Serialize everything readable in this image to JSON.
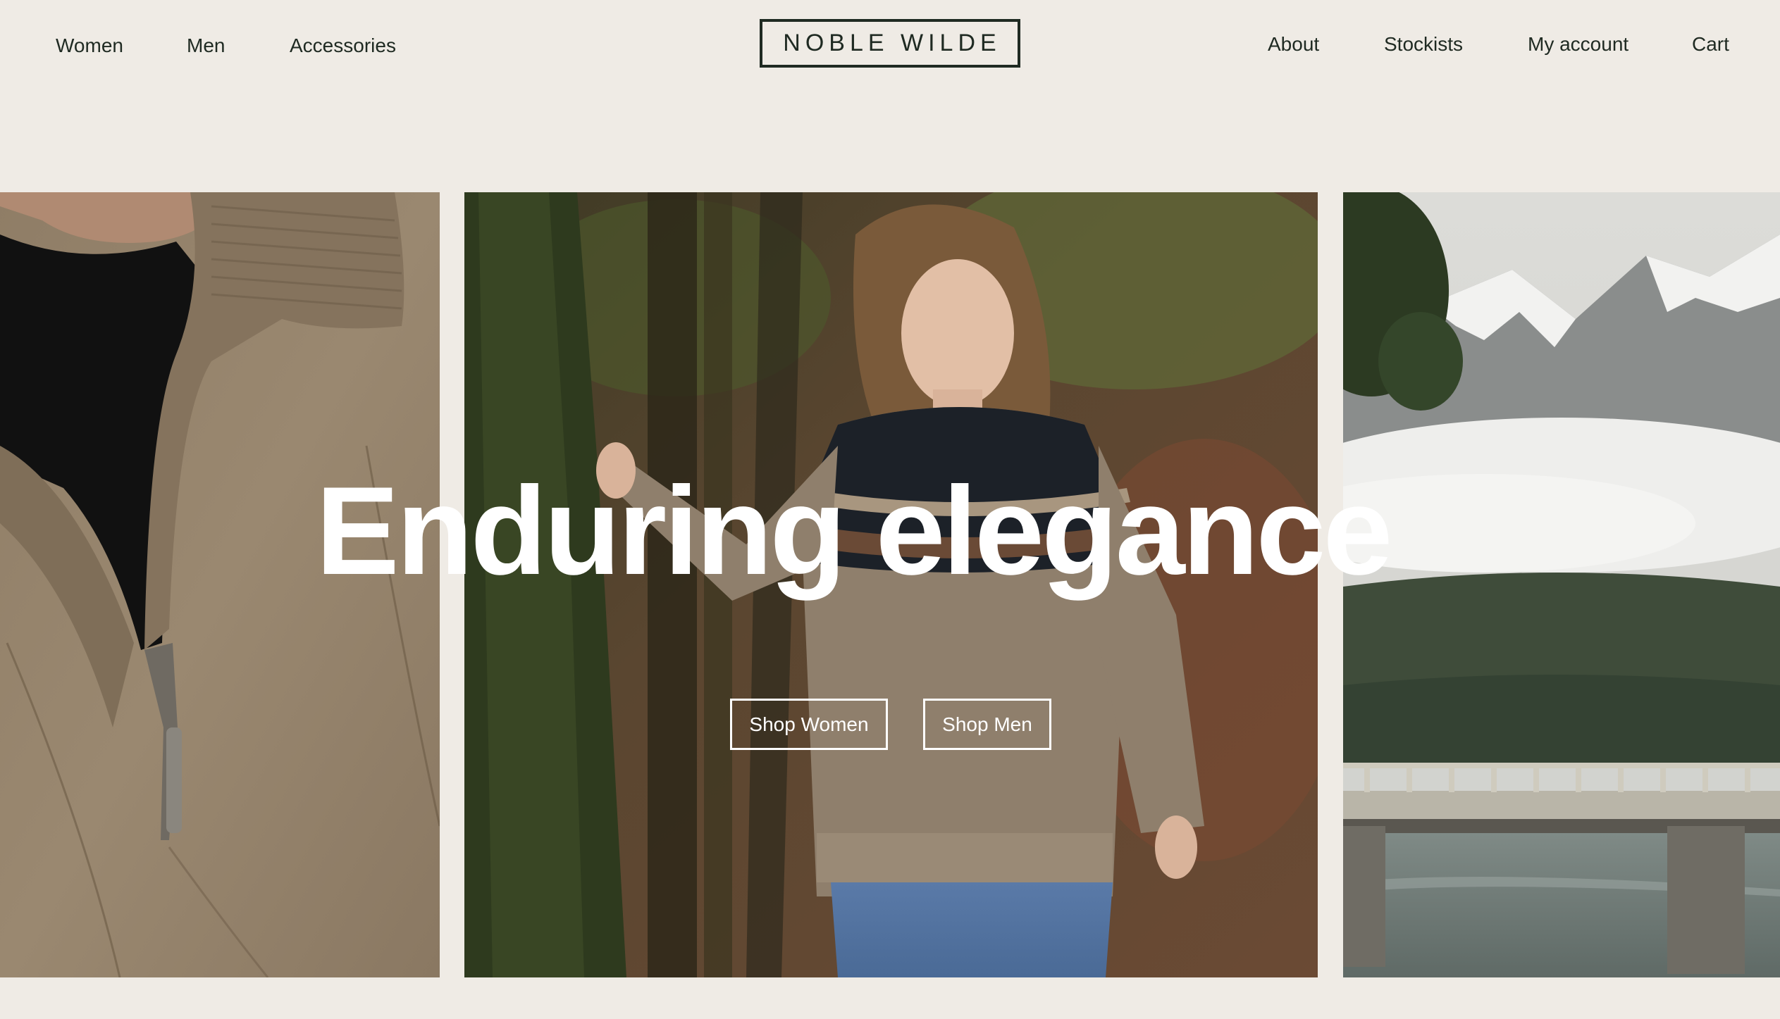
{
  "brand": {
    "logo_text": "NOBLE WILDE"
  },
  "nav": {
    "left": [
      {
        "label": "Women"
      },
      {
        "label": "Men"
      },
      {
        "label": "Accessories"
      }
    ],
    "right": [
      {
        "label": "About"
      },
      {
        "label": "Stockists"
      },
      {
        "label": "My account"
      },
      {
        "label": "Cart"
      }
    ]
  },
  "hero": {
    "headline": "Enduring elegance",
    "buttons": [
      {
        "label": "Shop Women"
      },
      {
        "label": "Shop Men"
      }
    ]
  },
  "colors": {
    "background": "#efebe5",
    "text": "#1f2a22",
    "hero_text": "#ffffff"
  }
}
